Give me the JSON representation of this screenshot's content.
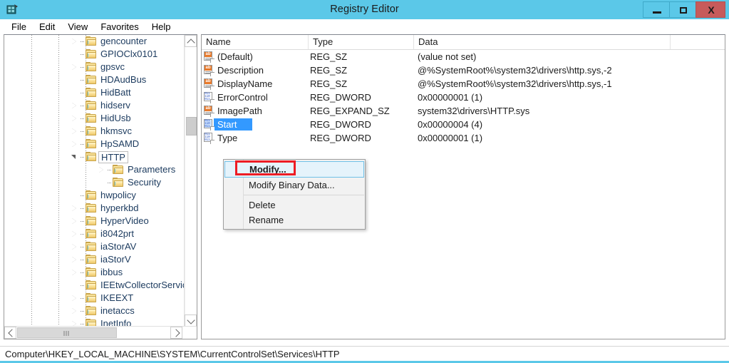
{
  "window": {
    "title": "Registry Editor",
    "icon": "registry-editor-icon",
    "controls": {
      "minimize": "minimize-icon",
      "maximize": "maximize-icon",
      "close": "X"
    },
    "titlebar_color": "#5bc8e8",
    "close_button_color": "#c75b5b"
  },
  "menubar": {
    "items": [
      {
        "label": "File"
      },
      {
        "label": "Edit"
      },
      {
        "label": "View"
      },
      {
        "label": "Favorites"
      },
      {
        "label": "Help"
      }
    ]
  },
  "tree": {
    "nodes": [
      {
        "label": "gencounter",
        "depth": 0,
        "state": "collapsed",
        "selected": false
      },
      {
        "label": "GPIOClx0101",
        "depth": 0,
        "state": "leaf",
        "selected": false
      },
      {
        "label": "gpsvc",
        "depth": 0,
        "state": "collapsed",
        "selected": false
      },
      {
        "label": "HDAudBus",
        "depth": 0,
        "state": "leaf",
        "selected": false
      },
      {
        "label": "HidBatt",
        "depth": 0,
        "state": "leaf",
        "selected": false
      },
      {
        "label": "hidserv",
        "depth": 0,
        "state": "collapsed",
        "selected": false
      },
      {
        "label": "HidUsb",
        "depth": 0,
        "state": "collapsed",
        "selected": false
      },
      {
        "label": "hkmsvc",
        "depth": 0,
        "state": "collapsed",
        "selected": false
      },
      {
        "label": "HpSAMD",
        "depth": 0,
        "state": "collapsed",
        "selected": false
      },
      {
        "label": "HTTP",
        "depth": 0,
        "state": "expanded",
        "selected": true
      },
      {
        "label": "Parameters",
        "depth": 1,
        "state": "collapsed",
        "selected": false
      },
      {
        "label": "Security",
        "depth": 1,
        "state": "leaf",
        "selected": false
      },
      {
        "label": "hwpolicy",
        "depth": 0,
        "state": "leaf",
        "selected": false
      },
      {
        "label": "hyperkbd",
        "depth": 0,
        "state": "collapsed",
        "selected": false
      },
      {
        "label": "HyperVideo",
        "depth": 0,
        "state": "collapsed",
        "selected": false
      },
      {
        "label": "i8042prt",
        "depth": 0,
        "state": "collapsed",
        "selected": false
      },
      {
        "label": "iaStorAV",
        "depth": 0,
        "state": "collapsed",
        "selected": false
      },
      {
        "label": "iaStorV",
        "depth": 0,
        "state": "collapsed",
        "selected": false
      },
      {
        "label": "ibbus",
        "depth": 0,
        "state": "collapsed",
        "selected": false
      },
      {
        "label": "IEEtwCollectorService",
        "depth": 0,
        "state": "leaf",
        "selected": false
      },
      {
        "label": "IKEEXT",
        "depth": 0,
        "state": "collapsed",
        "selected": false
      },
      {
        "label": "inetaccs",
        "depth": 0,
        "state": "collapsed",
        "selected": false
      },
      {
        "label": "InetInfo",
        "depth": 0,
        "state": "collapsed",
        "selected": false
      }
    ],
    "scroll": {
      "vertical_thumb": "scrollbar-thumb",
      "up_arrow": "chevron-up-icon",
      "down_arrow": "chevron-down-icon",
      "left_arrow": "chevron-left-icon",
      "right_arrow": "chevron-right-icon"
    }
  },
  "list": {
    "columns": [
      {
        "label": "Name"
      },
      {
        "label": "Type"
      },
      {
        "label": "Data"
      }
    ],
    "rows": [
      {
        "name": "(Default)",
        "type": "REG_SZ",
        "data": "(value not set)",
        "icon": "string-value-icon",
        "selected": false
      },
      {
        "name": "Description",
        "type": "REG_SZ",
        "data": "@%SystemRoot%\\system32\\drivers\\http.sys,-2",
        "icon": "string-value-icon",
        "selected": false
      },
      {
        "name": "DisplayName",
        "type": "REG_SZ",
        "data": "@%SystemRoot%\\system32\\drivers\\http.sys,-1",
        "icon": "string-value-icon",
        "selected": false
      },
      {
        "name": "ErrorControl",
        "type": "REG_DWORD",
        "data": "0x00000001 (1)",
        "icon": "dword-value-icon",
        "selected": false
      },
      {
        "name": "ImagePath",
        "type": "REG_EXPAND_SZ",
        "data": "system32\\drivers\\HTTP.sys",
        "icon": "string-value-icon",
        "selected": false
      },
      {
        "name": "Start",
        "type": "REG_DWORD",
        "data": "0x00000004 (4)",
        "icon": "dword-value-icon",
        "selected": true
      },
      {
        "name": "Type",
        "type": "REG_DWORD",
        "data": "0x00000001 (1)",
        "icon": "dword-value-icon",
        "selected": false
      }
    ]
  },
  "context_menu": {
    "items": [
      {
        "label": "Modify...",
        "bold": true,
        "hover": true,
        "separator_after": false
      },
      {
        "label": "Modify Binary Data...",
        "bold": false,
        "hover": false,
        "separator_after": true
      },
      {
        "label": "Delete",
        "bold": false,
        "hover": false,
        "separator_after": false
      },
      {
        "label": "Rename",
        "bold": false,
        "hover": false,
        "separator_after": false
      }
    ]
  },
  "annotation": {
    "color": "#ed1c24",
    "target": "Modify..."
  },
  "statusbar": {
    "path": "Computer\\HKEY_LOCAL_MACHINE\\SYSTEM\\CurrentControlSet\\Services\\HTTP"
  }
}
